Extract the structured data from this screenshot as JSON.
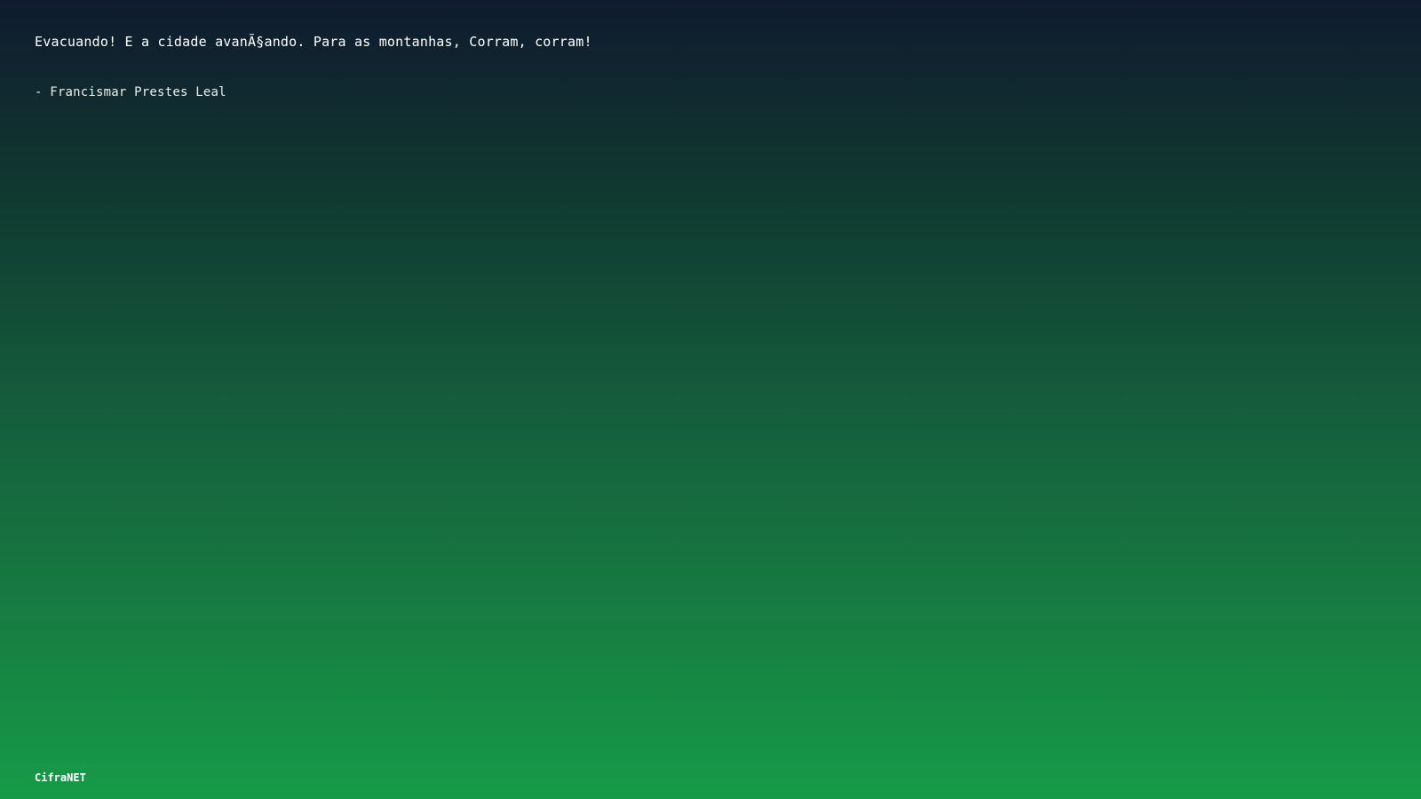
{
  "quote": {
    "text": "Evacuando! E a cidade avanÃ§ando. Para as montanhas, Corram, corram!",
    "author": "- Francismar Prestes Leal"
  },
  "footer": {
    "brand": "CifraNET"
  },
  "colors": {
    "gradient_top": "#0f1a2e",
    "gradient_bottom": "#169b47",
    "text": "#ffffff"
  }
}
